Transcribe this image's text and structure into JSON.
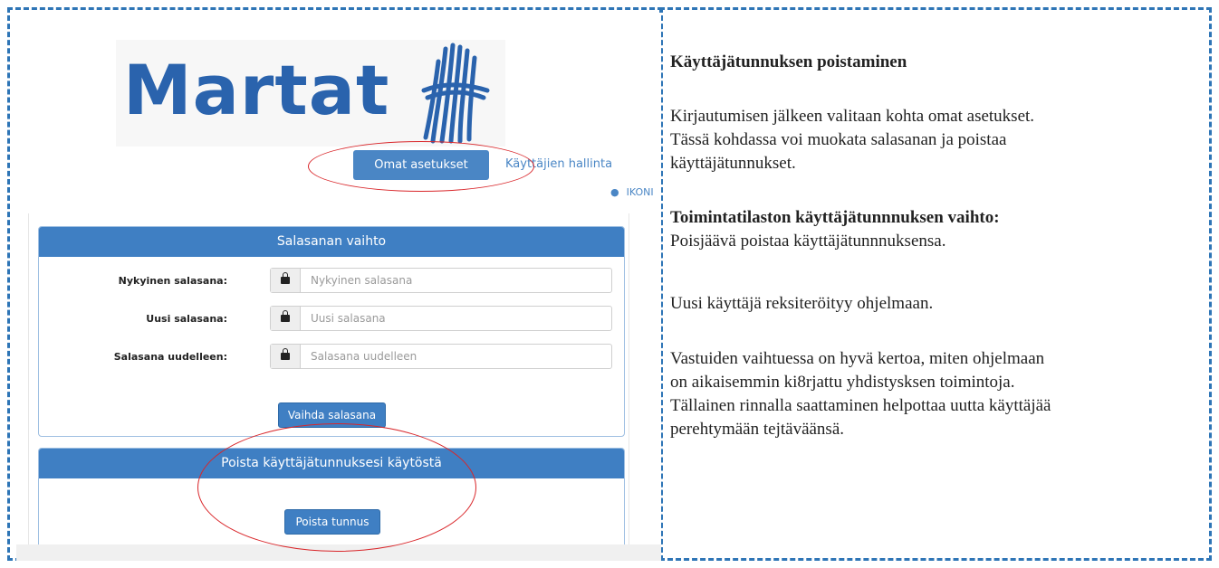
{
  "logo": {
    "text": "Martat"
  },
  "nav": {
    "settings_button": "Omat asetukset",
    "users_link": "Käyttäjien hallinta",
    "user_name": "IKONI"
  },
  "password_panel": {
    "title": "Salasanan vaihto",
    "fields": [
      {
        "label": "Nykyinen salasana:",
        "placeholder": "Nykyinen salasana"
      },
      {
        "label": "Uusi salasana:",
        "placeholder": "Uusi salasana"
      },
      {
        "label": "Salasana uudelleen:",
        "placeholder": "Salasana uudelleen"
      }
    ],
    "submit": "Vaihda salasana"
  },
  "delete_panel": {
    "title": "Poista käyttäjätunnuksesi käytöstä",
    "button": "Poista tunnus"
  },
  "instructions": {
    "heading": "Käyttäjätunnuksen poistaminen",
    "p1_lines": [
      "Kirjautumisen jälkeen valitaan kohta omat asetukset.",
      "Tässä kohdassa voi muokata salasanan ja poistaa",
      "käyttäjätunnukset."
    ],
    "heading2": "Toimintatilaston käyttäjätunnnuksen vaihto:",
    "p2": "Poisjäävä poistaa käyttäjätunnnuksensa.",
    "p3": "Uusi käyttäjä reksiteröityy ohjelmaan.",
    "p4_lines": [
      "Vastuiden vaihtuessa on hyvä kertoa, miten ohjelmaan",
      "on aikaisemmin ki8rjattu yhdistysksen toimintoja.",
      "Tällainen rinnalla saattaminen helpottaa uutta käyttäjää",
      "perehtymään tejtäväänsä."
    ]
  },
  "colors": {
    "frame": "#2e75b6",
    "primary": "#3f7fc3",
    "highlight": "#d9262a",
    "brand": "#2a63ad"
  }
}
